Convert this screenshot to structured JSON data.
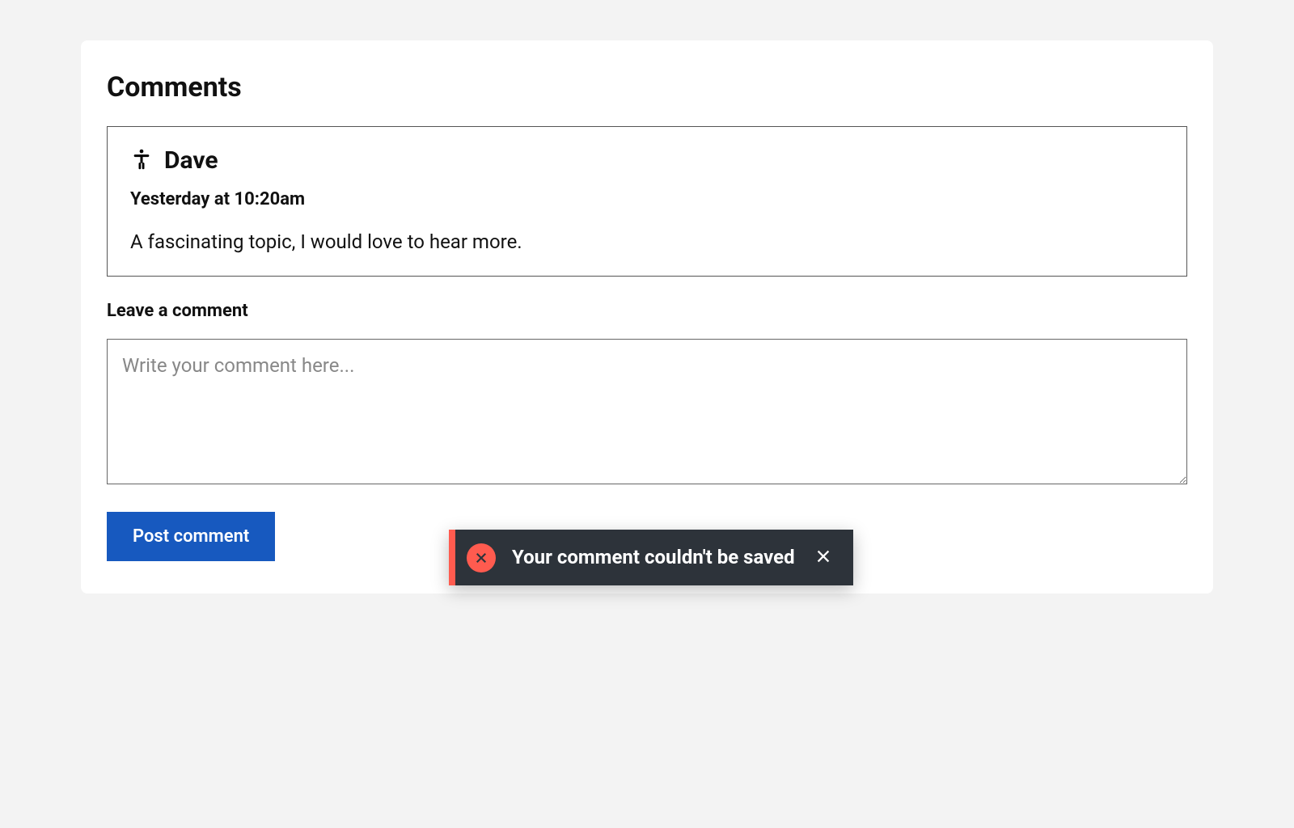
{
  "section": {
    "title": "Comments"
  },
  "comments": [
    {
      "author": "Dave",
      "timestamp": "Yesterday at 10:20am",
      "body": "A fascinating topic, I would love to hear more."
    }
  ],
  "form": {
    "label": "Leave a comment",
    "placeholder": "Write your comment here...",
    "submit_label": "Post comment"
  },
  "toast": {
    "message": "Your comment couldn't be saved",
    "type": "error"
  },
  "colors": {
    "primary": "#1759bf",
    "toast_bg": "#2d333a",
    "toast_accent": "#ff5b4f"
  }
}
